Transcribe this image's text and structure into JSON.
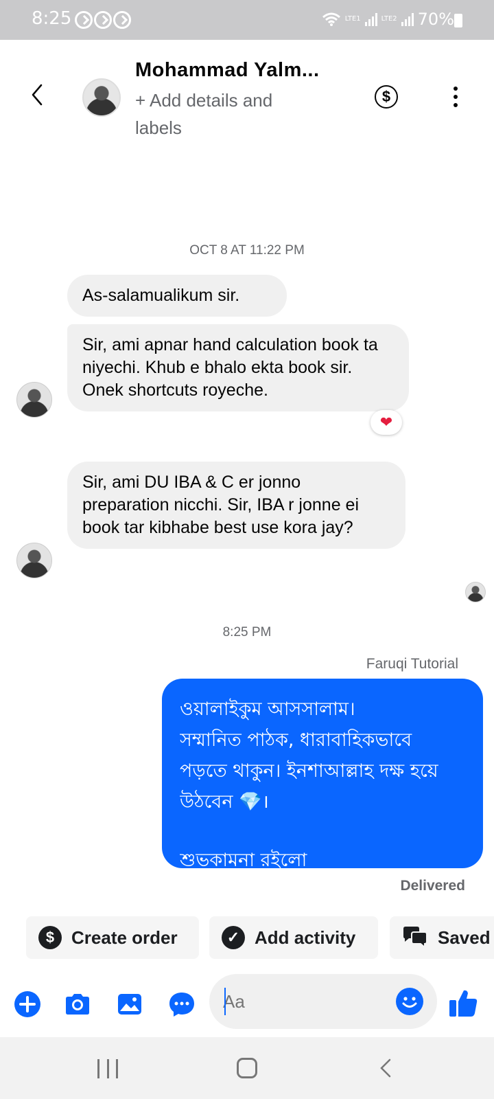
{
  "status_bar": {
    "time": "8:25",
    "battery": "70%",
    "sim1": "LTE1",
    "sim2": "LTE2"
  },
  "header": {
    "contact_name": "Mohammad Yalm...",
    "subtitle": "+ Add details and labels",
    "icons": [
      "back-arrow-icon",
      "avatar",
      "dollar-icon",
      "more-vertical-icon"
    ]
  },
  "conversation": {
    "timestamp_1": "OCT 8 AT 11:22 PM",
    "incoming": [
      {
        "text": "As-salamualikum sir."
      },
      {
        "text": "Sir, ami apnar hand calculation book ta niyechi. Khub e bhalo ekta book sir. Onek shortcuts royeche."
      },
      {
        "text": "Sir, ami DU IBA & C er jonno preparation nicchi. Sir, IBA r jonne ei book tar kibhabe best use kora jay?"
      }
    ],
    "reaction": "❤",
    "timestamp_2": "8:25 PM",
    "outgoing": {
      "sender": "Faruqi Tutorial",
      "lines": [
        "ওয়ালাইকুম আসসালাম।",
        "সম্মানিত পাঠক,  ধারাবাহিকভাবে",
        "পড়তে থাকুন।  ইনশাআল্লাহ দক্ষ হয়ে",
        "উঠবেন 💎।",
        "শুভকামনা রইলো"
      ],
      "status": "Delivered"
    }
  },
  "quick_actions": {
    "create_order": "Create order",
    "add_activity": "Add activity",
    "saved": "Saved"
  },
  "composer": {
    "placeholder": "Aa",
    "icons": [
      "plus-icon",
      "camera-icon",
      "gallery-icon",
      "chat-icon",
      "emoji-icon",
      "thumbs-up-icon"
    ]
  },
  "colors": {
    "accent": "#0a66ff",
    "incoming_bubble": "#f0f0f0",
    "reaction_heart": "#e41e3f",
    "status_bar": "#c9c9cb"
  }
}
